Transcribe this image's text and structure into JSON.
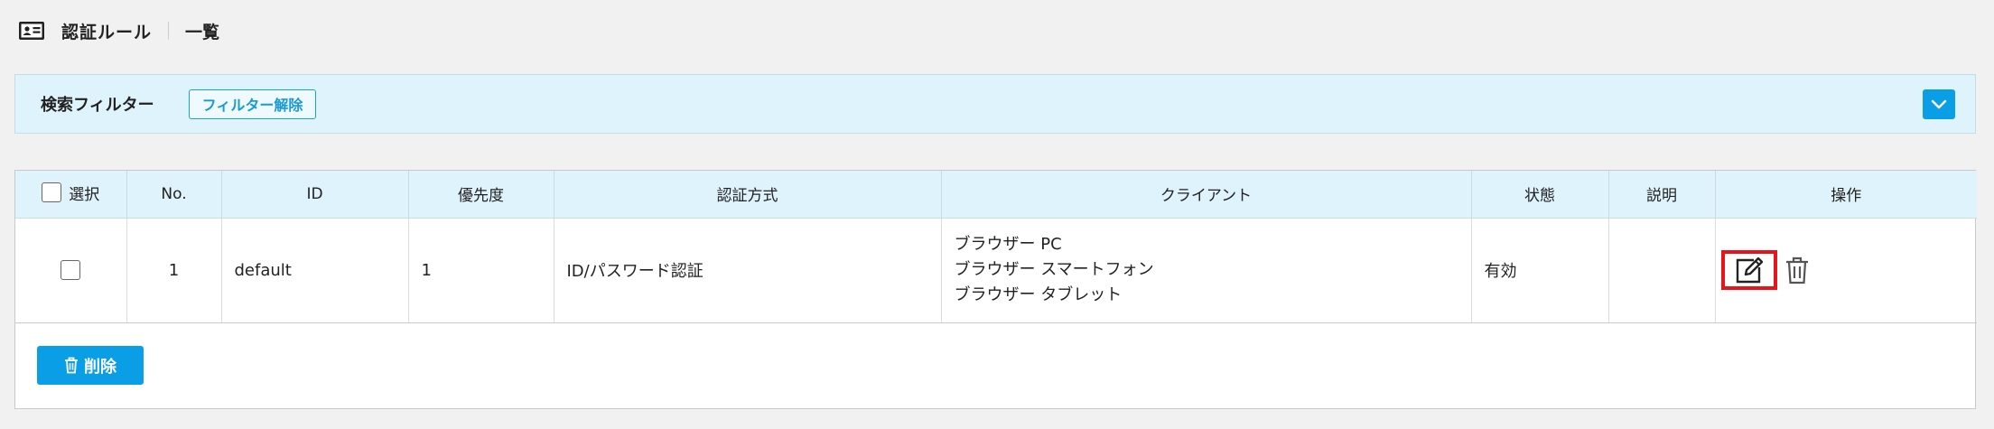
{
  "header": {
    "title": "認証ルール",
    "subtitle": "一覧",
    "icon": "id-card-icon"
  },
  "filter": {
    "title": "検索フィルター",
    "clear_label": "フィルター解除",
    "toggle_icon": "chevron-down-icon"
  },
  "table": {
    "headers": {
      "select": "選択",
      "no": "No.",
      "id": "ID",
      "priority": "優先度",
      "auth_method": "認証方式",
      "client": "クライアント",
      "status": "状態",
      "description": "説明",
      "operations": "操作"
    },
    "rows": [
      {
        "no": "1",
        "id": "default",
        "priority": "1",
        "auth_method": "ID/パスワード認証",
        "clients": [
          "ブラウザー PC",
          "ブラウザー スマートフォン",
          "ブラウザー タブレット"
        ],
        "status": "有効",
        "description": ""
      }
    ]
  },
  "actions": {
    "delete_label": "削除"
  },
  "colors": {
    "accent": "#0a9ee6",
    "header_bg": "#dff3fc",
    "highlight": "#e8141b"
  }
}
